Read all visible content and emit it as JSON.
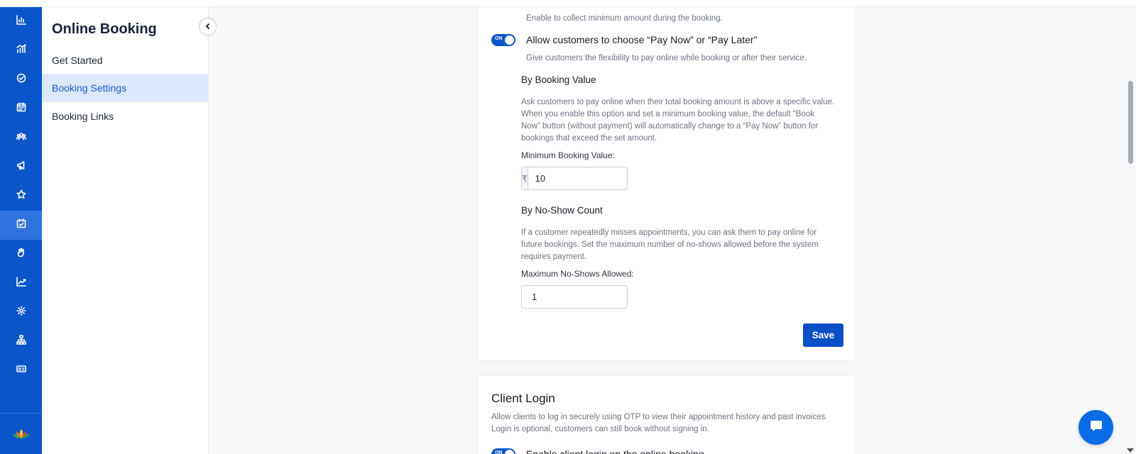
{
  "rail": {
    "icons": [
      "dashboard-icon",
      "analytics-icon",
      "check-circle-icon",
      "calendar-icon",
      "users-icon",
      "megaphone-icon",
      "star-icon",
      "booking-calendar-icon",
      "hand-icon",
      "trend-icon",
      "settings-icon",
      "org-chart-icon",
      "id-card-icon"
    ],
    "active_index": 7,
    "logo": "lotus-logo-icon"
  },
  "sidebar": {
    "title": "Online Booking",
    "items": [
      {
        "label": "Get Started"
      },
      {
        "label": "Booking Settings"
      },
      {
        "label": "Booking Links"
      }
    ],
    "active_index": 1
  },
  "payment_card": {
    "min_amount_desc": "Enable to collect minimum amount during the booking.",
    "pay_toggle_label": "Allow customers to choose “Pay Now” or “Pay Later”",
    "pay_toggle_state": "ON",
    "pay_toggle_desc": "Give customers the flexibility to pay online while booking or after their service.",
    "booking_value": {
      "title": "By Booking Value",
      "desc_lines": [
        "Ask customers to pay online when their total booking amount is above a specific value.",
        "When you enable this option and set a minimum booking value, the default “Book",
        "Now” button (without payment) will automatically change to a “Pay Now” button for",
        "bookings that exceed the set amount."
      ],
      "field_label": "Minimum Booking Value:",
      "currency": "₹",
      "value": "10"
    },
    "no_show": {
      "title": "By No-Show Count",
      "desc_lines": [
        "If a customer repeatedly misses appointments, you can ask them to pay online for",
        "future bookings. Set the maximum number of no-shows allowed before the system",
        "requires payment."
      ],
      "field_label": "Maximum No-Shows Allowed:",
      "value": "1"
    },
    "save_label": "Save"
  },
  "client_login": {
    "title": "Client Login",
    "desc_lines": [
      "Allow clients to log in securely using OTP to view their appointment history and past invoices.",
      "Login is optional, customers can still book without signing in."
    ],
    "toggle_state": "ON",
    "toggle_label": "Enable client login on the online booking"
  },
  "colors": {
    "rail_bg": "#0a55c9",
    "accent": "#0a4fc7",
    "active_nav_bg": "#dce8fb",
    "chat_fab": "#0a6ce6"
  }
}
